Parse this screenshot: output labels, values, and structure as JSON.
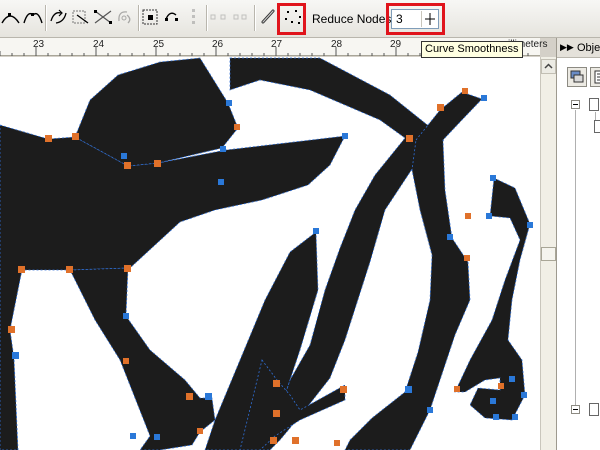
{
  "toolbar": {
    "icons": [
      "make-smooth-icon",
      "make-symmetrical-icon",
      "reverse-curve-direction-icon",
      "extract-subpath-icon",
      "stretch-scale-nodes-icon",
      "rotate-skew-nodes-icon",
      "align-nodes-icon",
      "reflect-nodes-horizontally-icon",
      "reflect-nodes-vertically-icon",
      "elastic-mode-icon",
      "select-all-nodes-icon"
    ],
    "reduce_nodes_label": "Reduce Nodes",
    "curve_smoothness_value": "3",
    "highlight_color": "#e0141c"
  },
  "ruler": {
    "numbers": [
      "23",
      "24",
      "25",
      "26",
      "27",
      "28",
      "29"
    ],
    "unit": "illimeters"
  },
  "tooltip": {
    "text": "Curve Smoothness"
  },
  "docker": {
    "title": "Obje",
    "expand_icon": "double-chevron-right-icon"
  },
  "canvas": {
    "shape_fill": "#1c1c1c",
    "outline_color": "#2f6fd6",
    "node_colors": [
      "#e0712a",
      "#2a78d8"
    ]
  }
}
